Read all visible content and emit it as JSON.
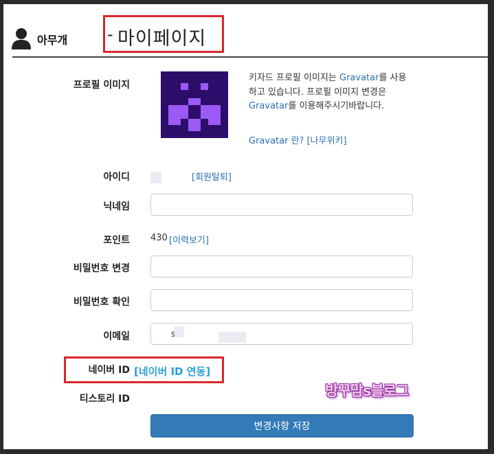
{
  "header": {
    "username": "아무개",
    "title_dash": "-",
    "title": "마이페이지"
  },
  "profile": {
    "image_label": "프로필 이미지",
    "desc_1": "키자드 프로필 이미지는 ",
    "gravatar_1": "Gravatar",
    "desc_2": "를 사용하고 있습니다. 프로필 이미지 변경은 ",
    "gravatar_2": "Gravatar",
    "desc_3": "를 이용해주시기바랍니다.",
    "gravatar_what": "Gravatar 란?",
    "namuwiki": "[나무위키]"
  },
  "id_row": {
    "label": "아이디",
    "withdraw_link": "[회원탈퇴]"
  },
  "nickname": {
    "label": "닉네임",
    "value": ""
  },
  "points": {
    "label": "포인트",
    "value": "430",
    "history_link": "[이력보기]"
  },
  "password": {
    "label": "비밀번호 변경",
    "value": ""
  },
  "password_confirm": {
    "label": "비밀번호 확인",
    "value": ""
  },
  "email": {
    "label": "이메일",
    "value": "s"
  },
  "naver": {
    "label": "네이버 ID",
    "link": "[네이버 ID 연동]"
  },
  "tistory": {
    "label": "티스토리 ID"
  },
  "watermark": "방꾸맘s블로그",
  "save_button": "변경사항 저장",
  "colors": {
    "accent": "#337ab7",
    "link": "#2a6fb3",
    "highlight_box": "#d9262b",
    "avatar_bg": "#2d0d6a",
    "avatar_pixel": "#9b59f5"
  }
}
